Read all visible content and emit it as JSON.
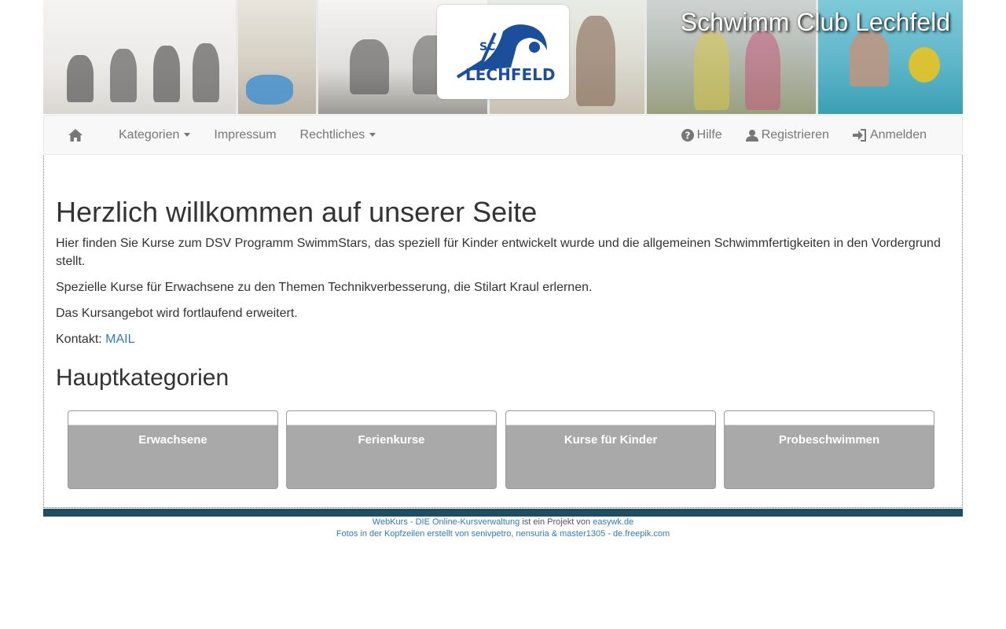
{
  "header": {
    "site_title": "Schwimm Club Lechfeld",
    "logo_text_top": "SC",
    "logo_text_bottom": "LECHFELD"
  },
  "navbar": {
    "home_icon": "home-icon",
    "kategorien": "Kategorien",
    "impressum": "Impressum",
    "rechtliches": "Rechtliches",
    "hilfe": "Hilfe",
    "registrieren": "Registrieren",
    "anmelden": "Anmelden"
  },
  "main": {
    "title": "Herzlich willkommen auf unserer Seite",
    "para1": "Hier finden Sie Kurse zum DSV Programm SwimmStars, das speziell für Kinder entwickelt wurde und die allgemeinen Schwimmfertigkeiten in den Vordergrund stellt.",
    "para2": "Spezielle Kurse für Erwachsene zu den Themen Technikverbesserung, die Stilart Kraul erlernen.",
    "para3": "Das Kursangebot wird fortlaufend erweitert.",
    "contact_label": "Kontakt: ",
    "contact_link": "MAIL",
    "categories_heading": "Hauptkategorien",
    "categories": [
      "Erwachsene",
      "Ferienkurse",
      "Kurse für Kinder",
      "Probeschwimmen"
    ]
  },
  "footer": {
    "line1_link1": "WebKurs - DIE Online-Kursverwaltung",
    "line1_text": " ist ein Projekt von ",
    "line1_link2": "easywk.de",
    "line2_link": "Fotos in der Kopfzeilen erstellt von senivpetro, nensuria & master1305 - de.freepik.com"
  },
  "colors": {
    "navbar_bg": "#f8f8f8",
    "link": "#337ab7",
    "footer_bar": "#1f4e63",
    "card_bg": "#a9a9a9",
    "logo_blue": "#1b4f9c"
  }
}
